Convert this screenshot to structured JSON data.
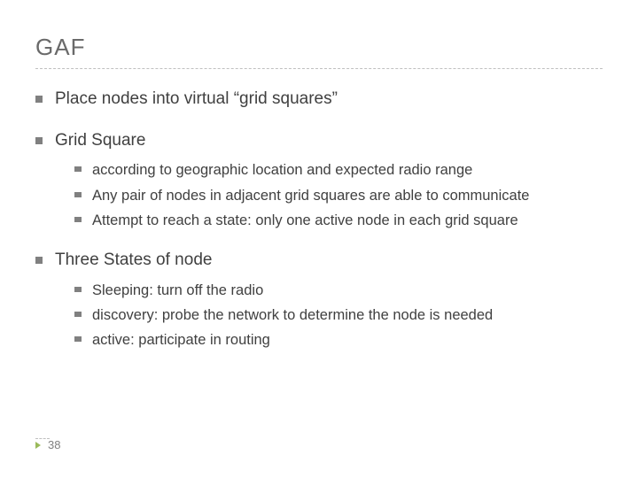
{
  "title": "GAF",
  "bullets": {
    "b1": "Place nodes into virtual “grid squares”",
    "b2": "Grid Square",
    "b2_sub": {
      "s1": "according to geographic location and expected radio range",
      "s2": "Any pair of nodes in adjacent grid squares are able to communicate",
      "s3": "Attempt to reach a state: only one active node in each grid square"
    },
    "b3": "Three States of node",
    "b3_sub": {
      "s1": "Sleeping: turn off the radio",
      "s2": "discovery: probe the network to determine the node is needed",
      "s3": "active: participate in routing"
    }
  },
  "page_number": "38"
}
